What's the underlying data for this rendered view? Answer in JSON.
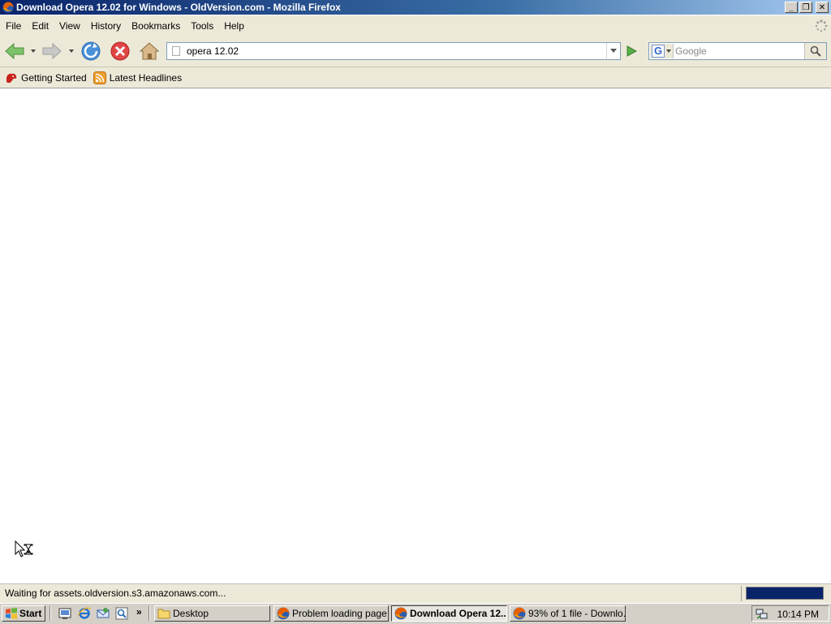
{
  "window": {
    "title": "Download Opera 12.02 for Windows - OldVersion.com - Mozilla Firefox",
    "minimize_label": "_",
    "maximize_label": "❐",
    "close_label": "✕"
  },
  "menu": {
    "file": "File",
    "edit": "Edit",
    "view": "View",
    "history": "History",
    "bookmarks": "Bookmarks",
    "tools": "Tools",
    "help": "Help"
  },
  "navigation": {
    "url_value": "opera 12.02",
    "search_engine": "G",
    "search_placeholder": "Google"
  },
  "bookmarks_toolbar": {
    "items": [
      {
        "label": "Getting Started",
        "icon": "firefox-bookmark-icon"
      },
      {
        "label": "Latest Headlines",
        "icon": "rss-feed-icon"
      }
    ]
  },
  "status_bar": {
    "text": "Waiting for assets.oldversion.s3.amazonaws.com...",
    "progress_fraction": 1.0
  },
  "taskbar": {
    "start_label": "Start",
    "quick_launch_more": "»",
    "tasks": [
      {
        "label": "Desktop",
        "icon": "folder-icon",
        "active": false
      },
      {
        "label": "Problem loading page ...",
        "icon": "firefox-icon",
        "active": false
      },
      {
        "label": "Download Opera 12...",
        "icon": "firefox-icon",
        "active": true
      },
      {
        "label": "93% of 1 file - Downlo...",
        "icon": "firefox-icon",
        "active": false
      }
    ],
    "clock": "10:14 PM"
  },
  "colors": {
    "titlebar_start": "#0a246a",
    "titlebar_end": "#a6caf0",
    "chrome": "#ece9d8",
    "taskbar": "#d4d0c8",
    "progress": "#0a246a"
  }
}
